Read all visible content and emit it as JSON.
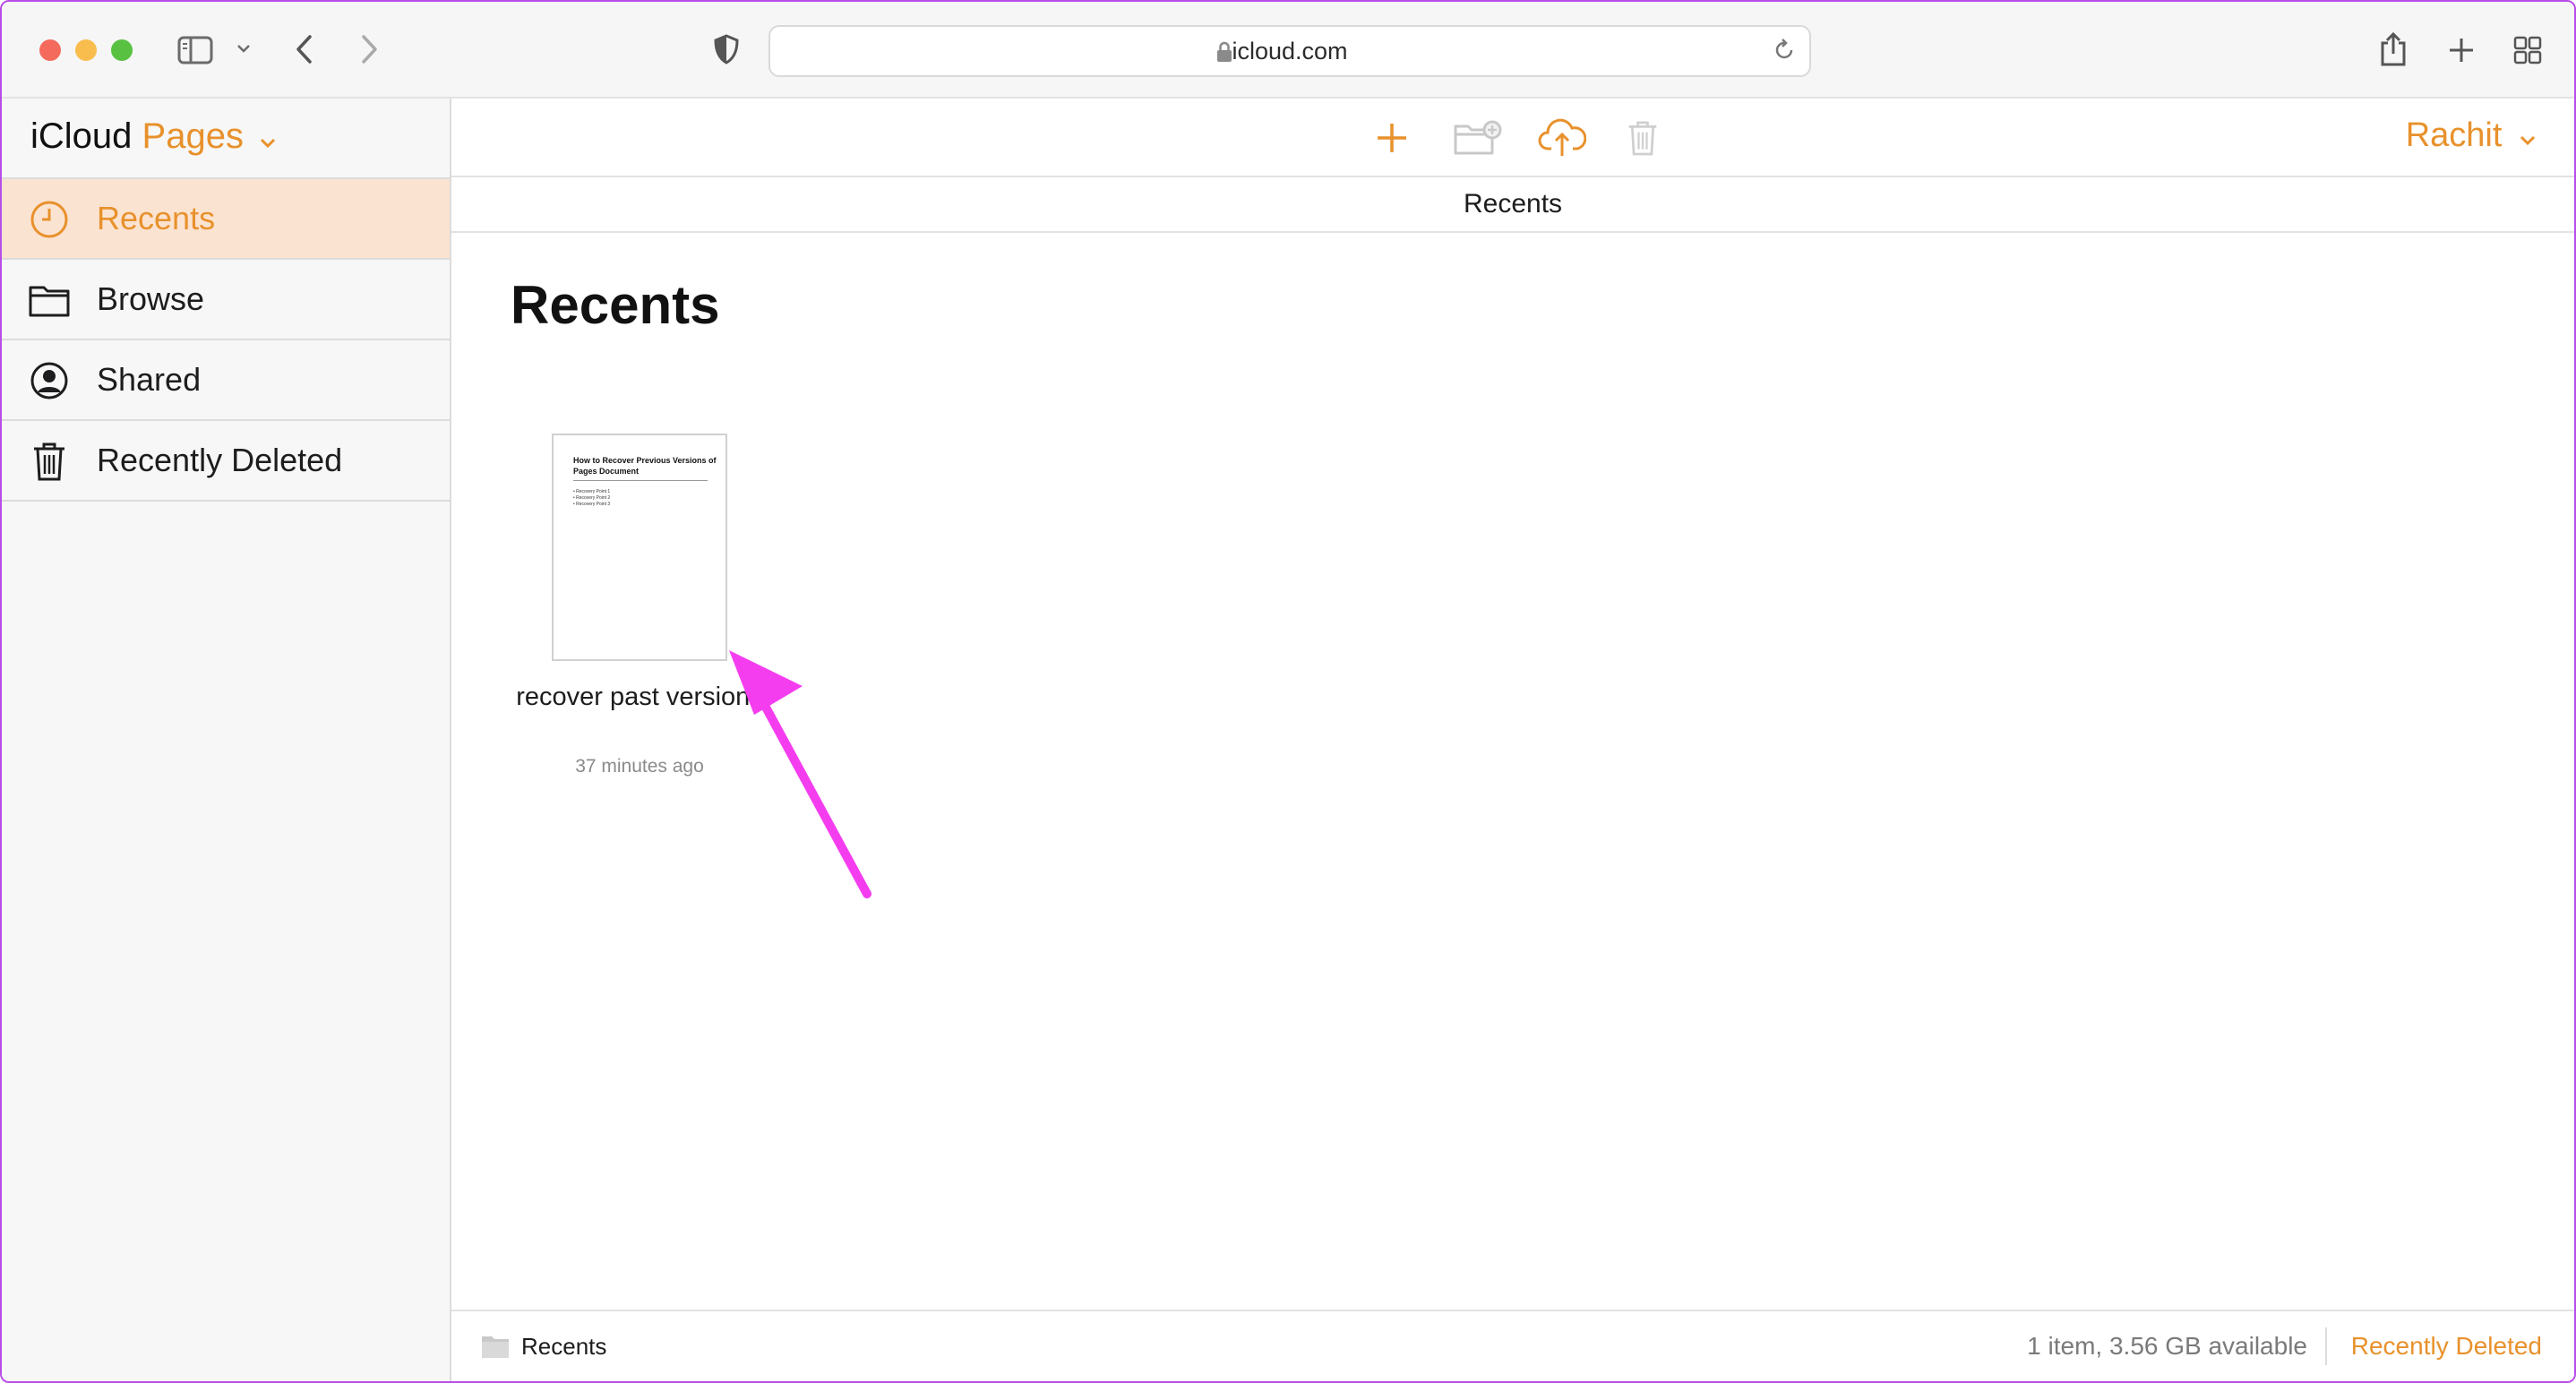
{
  "browser": {
    "url": "icloud.com",
    "icons": [
      "sidebar-toggle-icon",
      "chevron-down-icon",
      "back-icon",
      "forward-icon",
      "shield-icon",
      "lock-icon",
      "reload-icon",
      "share-icon",
      "new-tab-icon",
      "tab-overview-icon"
    ]
  },
  "app": {
    "brand_prefix": "iCloud",
    "brand_app": "Pages",
    "accent_color": "#e8912c"
  },
  "sidebar": {
    "items": [
      {
        "label": "Recents",
        "icon": "clock-icon",
        "active": true
      },
      {
        "label": "Browse",
        "icon": "folder-icon",
        "active": false
      },
      {
        "label": "Shared",
        "icon": "person-circle-icon",
        "active": false
      },
      {
        "label": "Recently Deleted",
        "icon": "trash-icon",
        "active": false
      }
    ]
  },
  "toolbar": {
    "icons": [
      "plus-icon",
      "new-folder-icon",
      "upload-cloud-icon",
      "trash-icon"
    ],
    "user": "Rachit"
  },
  "main": {
    "subheader": "Recents",
    "title": "Recents",
    "documents": [
      {
        "name": "recover past versions",
        "time": "37 minutes ago",
        "thumb_title": "How to Recover Previous Versions of Pages Document",
        "thumb_lines": [
          "• Recovery Point 1",
          "• Recovery Point 2",
          "• Recovery Point 3"
        ]
      }
    ]
  },
  "statusbar": {
    "location": "Recents",
    "info": "1 item, 3.56 GB available",
    "recently_deleted": "Recently Deleted"
  },
  "annotation": {
    "arrow_color": "#f53df0"
  }
}
